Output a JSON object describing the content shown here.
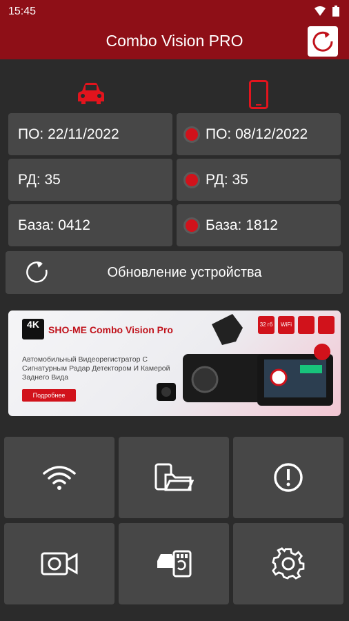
{
  "status_bar": {
    "time": "15:45"
  },
  "app_bar": {
    "title": "Combo Vision PRO"
  },
  "left_column": {
    "firmware": "ПО: 22/11/2022",
    "radar": "РД: 35",
    "database": "База: 0412"
  },
  "right_column": {
    "firmware": "ПО: 08/12/2022",
    "radar": "РД: 35",
    "database": "База: 1812"
  },
  "update_button": {
    "label": "Обновление устройства"
  },
  "banner": {
    "badge": "4K",
    "title": "SHO-ME Combo Vision Pro",
    "description": "Автомобильный Видеорегистратор С Сигнатурным Радар Детектором И Камерой Заднего Вида",
    "more_label": "Подробнее",
    "tags": [
      "32 гб",
      "WiFi",
      "",
      ""
    ]
  },
  "colors": {
    "accent": "#8e0f17",
    "dot": "#d1121b",
    "card": "#474747",
    "background": "#2b2b2b"
  },
  "grid_icons": [
    "wifi-icon",
    "file-transfer-icon",
    "info-icon",
    "camera-icon",
    "sd-card-icon",
    "settings-icon"
  ]
}
